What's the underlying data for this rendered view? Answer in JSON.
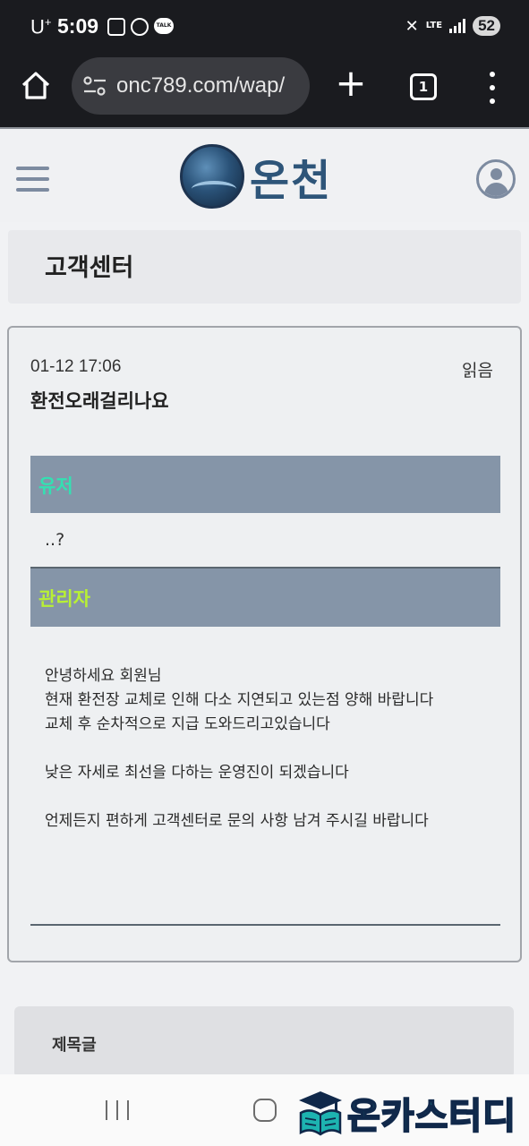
{
  "status_bar": {
    "carrier": "U",
    "carrier_sup": "+",
    "time": "5:09",
    "network": "LTE",
    "battery": "52",
    "talk_badge": "TALK",
    "icons": [
      "screenshot-icon",
      "gear-icon",
      "talk-icon",
      "mute-icon",
      "lte-icon",
      "signal-icon"
    ]
  },
  "browser": {
    "url": "onc789.com/wap/",
    "tab_count": "1",
    "new_tab_label": "+"
  },
  "site": {
    "logo_text": "온천",
    "page_title": "고객센터"
  },
  "post": {
    "date": "01-12 17:06",
    "status": "읽음",
    "subject": "환전오래걸리나요",
    "user_label": "유저",
    "user_message": "..?",
    "admin_label": "관리자",
    "admin_reply": [
      "안녕하세요 회원님",
      "현재 환전장 교체로 인해 다소 지연되고 있는점 양해 바랍니다",
      "교체 후 순차적으로 지급 도와드리고있습니다",
      "낮은 자세로 최선을 다하는 운영진이 되겠습니다",
      "언제든지 편하게 고객센터로 문의 사항 남겨 주시길 바랍니다"
    ]
  },
  "table": {
    "header": "제목글"
  },
  "watermark": {
    "text": "온카스터디"
  },
  "colors": {
    "user_label": "#34e0b2",
    "admin_label": "#b8f035",
    "bar_bg": "#8595a8",
    "logo": "#2e5579"
  }
}
